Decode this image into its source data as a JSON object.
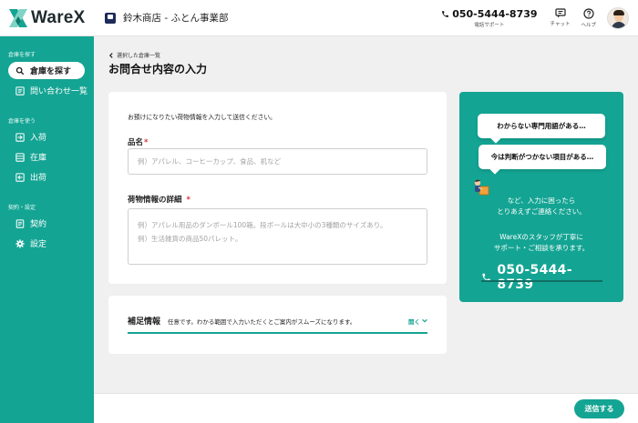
{
  "header": {
    "logo_text": "WareX",
    "store_name": "鈴木商店 - ふとん事業部",
    "phone": "050-5444-8739",
    "phone_label": "電話サポート",
    "chat_label": "チャット",
    "help_label": "ヘルプ"
  },
  "sidebar": {
    "sections": [
      {
        "title": "倉庫を探す",
        "items": [
          {
            "label": "倉庫を探す",
            "icon": "search-icon",
            "active": true
          },
          {
            "label": "問い合わせ一覧",
            "icon": "list-icon",
            "active": false
          }
        ]
      },
      {
        "title": "倉庫を使う",
        "items": [
          {
            "label": "入荷",
            "icon": "inbound-icon"
          },
          {
            "label": "在庫",
            "icon": "inventory-icon"
          },
          {
            "label": "出荷",
            "icon": "outbound-icon"
          }
        ]
      },
      {
        "title": "契約・設定",
        "items": [
          {
            "label": "契約",
            "icon": "contract-icon"
          },
          {
            "label": "設定",
            "icon": "gear-icon"
          }
        ]
      }
    ]
  },
  "main": {
    "breadcrumb": "選択した倉庫一覧",
    "title": "お問合せ内容の入力",
    "intro": "お預けになりたい荷物情報を入力して送信ください。",
    "product_label": "品名",
    "product_placeholder": "例）アパレル、コーヒーカップ、食品、机など",
    "detail_label": "荷物情報の詳細",
    "detail_placeholder_line1": "例）アパレル用品のダンボール100箱。段ボールは大中小の3種類のサイズあり。",
    "detail_placeholder_line2": "例）生活雑貨の商品50パレット。",
    "required_mark": "*",
    "supplement_title": "補足情報",
    "supplement_note": "任意です。わかる範囲で入力いただくとご案内がスムーズになります。",
    "supplement_toggle": "開く"
  },
  "help_panel": {
    "bubble1": "わからない専門用語がある…",
    "bubble2": "今は判断がつかない項目がある…",
    "text1_line1": "など、入力に困ったら",
    "text1_line2": "とりあえずご連絡ください。",
    "text2_line1": "WareXのスタッフが丁寧に",
    "text2_line2": "サポート・ご相談を承ります。",
    "phone": "050-5444-8739"
  },
  "footer": {
    "send_label": "送信する"
  },
  "colors": {
    "accent": "#14a493",
    "required": "#d9363e",
    "navy": "#1d2b5a"
  }
}
